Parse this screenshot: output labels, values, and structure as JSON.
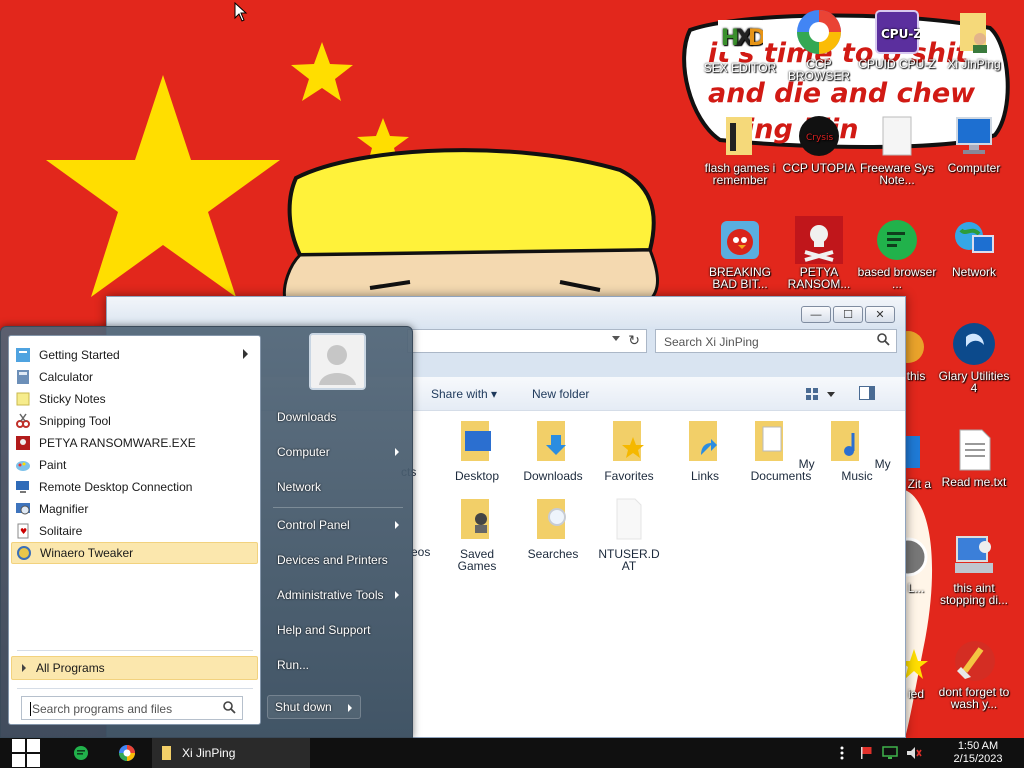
{
  "wallpaper": {
    "speech_text": [
      "it's time to o shit",
      "and die and chew",
      "ing illin"
    ],
    "colors": {
      "flag_red": "#e2271c",
      "star_yellow": "#ffde00",
      "hat_yellow": "#fff23a"
    }
  },
  "desktop_icons": [
    {
      "label": "SEX EDITOR",
      "icon": "hex-editor-icon"
    },
    {
      "label": "CCP BROWSER",
      "icon": "browser-icon"
    },
    {
      "label": "CPUID CPU-Z",
      "icon": "cpuz-icon"
    },
    {
      "label": "Xi JinPing",
      "icon": "user-folder-icon"
    },
    {
      "label": "flash games i remember",
      "icon": "folder-icon"
    },
    {
      "label": "CCP UTOPIA",
      "icon": "utopia-icon"
    },
    {
      "label": "Freeware Sys Note...",
      "icon": "notepad-icon"
    },
    {
      "label": "Computer",
      "icon": "computer-icon"
    },
    {
      "label": "BREAKING BAD BIT...",
      "icon": "angry-birds-icon"
    },
    {
      "label": "PETYA RANSOM...",
      "icon": "skull-icon"
    },
    {
      "label": "based browser ...",
      "icon": "chat-icon"
    },
    {
      "label": "Network",
      "icon": "network-icon"
    },
    {
      "label": "this",
      "icon": "partial-icon"
    },
    {
      "label": "Glary Utilities 4",
      "icon": "glary-icon"
    },
    {
      "label": "t Zit a",
      "icon": "partial-icon"
    },
    {
      "label": "Read me.txt",
      "icon": "text-file-icon"
    },
    {
      "label": "L...",
      "icon": "partial-icon"
    },
    {
      "label": "this aint stopping di...",
      "icon": "installer-icon"
    },
    {
      "label": "ied",
      "icon": "partial-icon"
    },
    {
      "label": "dont forget to wash y...",
      "icon": "cleaner-icon"
    }
  ],
  "explorer": {
    "window_controls": {
      "minimize": "—",
      "maximize": "☐",
      "close": "✕"
    },
    "search_placeholder": "Search Xi JinPing",
    "toolbar": {
      "share_with": "Share with",
      "new_folder": "New folder"
    },
    "items": [
      {
        "label": "Desktop",
        "icon": "desktop-folder-icon"
      },
      {
        "label": "Downloads",
        "icon": "downloads-folder-icon"
      },
      {
        "label": "Favorites",
        "icon": "favorites-folder-icon"
      },
      {
        "label": "Links",
        "icon": "links-folder-icon"
      },
      {
        "label": "My Documents",
        "icon": "documents-folder-icon"
      },
      {
        "label": "My Music",
        "icon": "music-folder-icon"
      },
      {
        "label": "Saved Games",
        "icon": "saved-games-folder-icon"
      },
      {
        "label": "Searches",
        "icon": "searches-folder-icon"
      },
      {
        "label": "NTUSER.DAT",
        "icon": "blank-file-icon"
      }
    ],
    "partial_labels": {
      "contacts_tail": "cts",
      "videos_tail": "eos"
    }
  },
  "start_menu": {
    "programs": [
      {
        "label": "Getting Started",
        "icon": "getting-started-icon",
        "arrow": true
      },
      {
        "label": "Calculator",
        "icon": "calculator-icon"
      },
      {
        "label": "Sticky Notes",
        "icon": "sticky-notes-icon"
      },
      {
        "label": "Snipping Tool",
        "icon": "snipping-tool-icon"
      },
      {
        "label": "PETYA RANSOMWARE.EXE",
        "icon": "petya-icon"
      },
      {
        "label": "Paint",
        "icon": "paint-icon"
      },
      {
        "label": "Remote Desktop Connection",
        "icon": "remote-desktop-icon"
      },
      {
        "label": "Magnifier",
        "icon": "magnifier-icon"
      },
      {
        "label": "Solitaire",
        "icon": "solitaire-icon"
      },
      {
        "label": "Winaero Tweaker",
        "icon": "winaero-icon",
        "highlighted": true
      }
    ],
    "all_programs": "All Programs",
    "search_placeholder": "Search programs and files",
    "right_items": [
      {
        "label": "Downloads"
      },
      {
        "label": "Computer",
        "arrow": true
      },
      {
        "label": "Network"
      },
      {
        "label": "Control Panel",
        "arrow": true
      },
      {
        "label": "Devices and Printers"
      },
      {
        "label": "Administrative Tools",
        "arrow": true
      },
      {
        "label": "Help and Support"
      },
      {
        "label": "Run..."
      }
    ],
    "shutdown": "Shut down"
  },
  "taskbar": {
    "window_label": "Xi JinPing",
    "clock_time": "1:50 AM",
    "clock_date": "2/15/2023"
  }
}
